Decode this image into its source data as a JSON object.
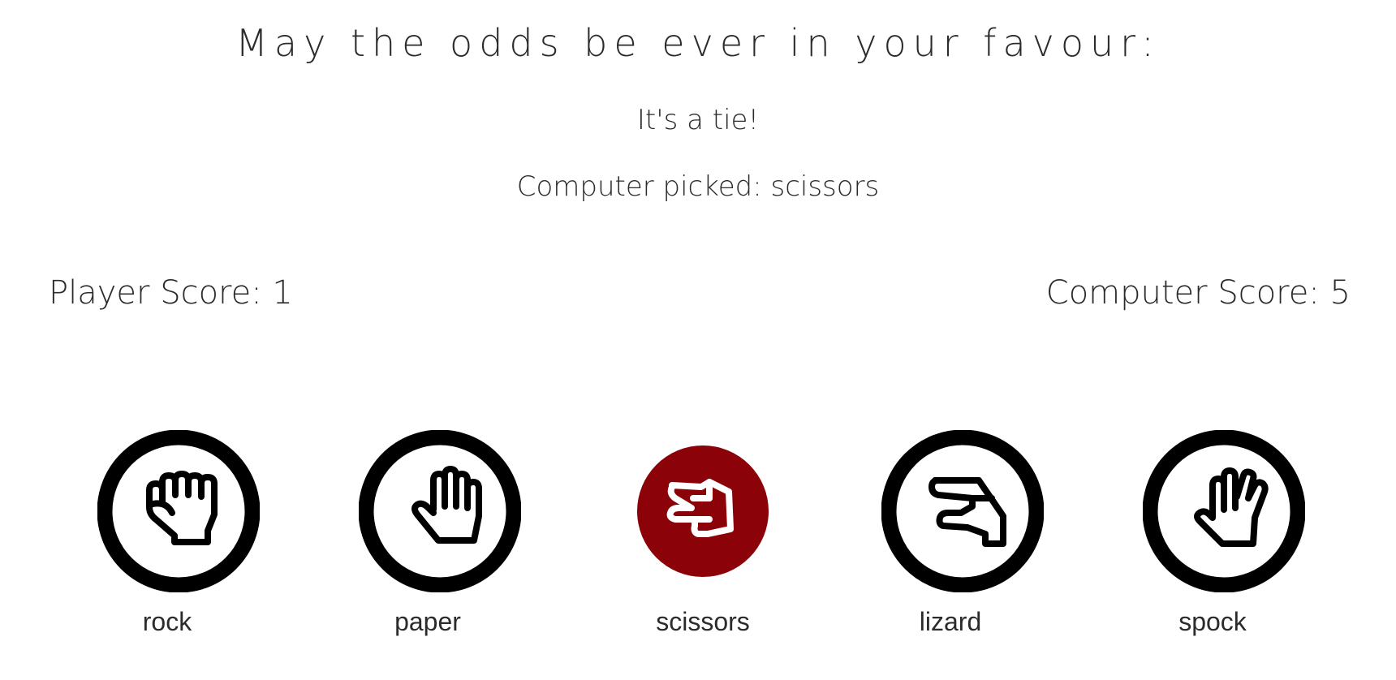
{
  "heading": "May the odds be ever in your favour:",
  "result_text": "It's a tie!",
  "computer_pick": "Computer picked: scissors",
  "scores": {
    "player": "Player Score: 1",
    "computer": "Computer Score: 5"
  },
  "choices": [
    {
      "label": "rock",
      "icon": "rock-hand-icon"
    },
    {
      "label": "paper",
      "icon": "paper-hand-icon"
    },
    {
      "label": "scissors",
      "icon": "scissors-hand-icon"
    },
    {
      "label": "lizard",
      "icon": "lizard-hand-icon"
    },
    {
      "label": "spock",
      "icon": "spock-hand-icon"
    }
  ],
  "selected_choice": "scissors",
  "colors": {
    "selected": "#8b0309",
    "outline": "#000000",
    "text": "#2b2b2b"
  }
}
